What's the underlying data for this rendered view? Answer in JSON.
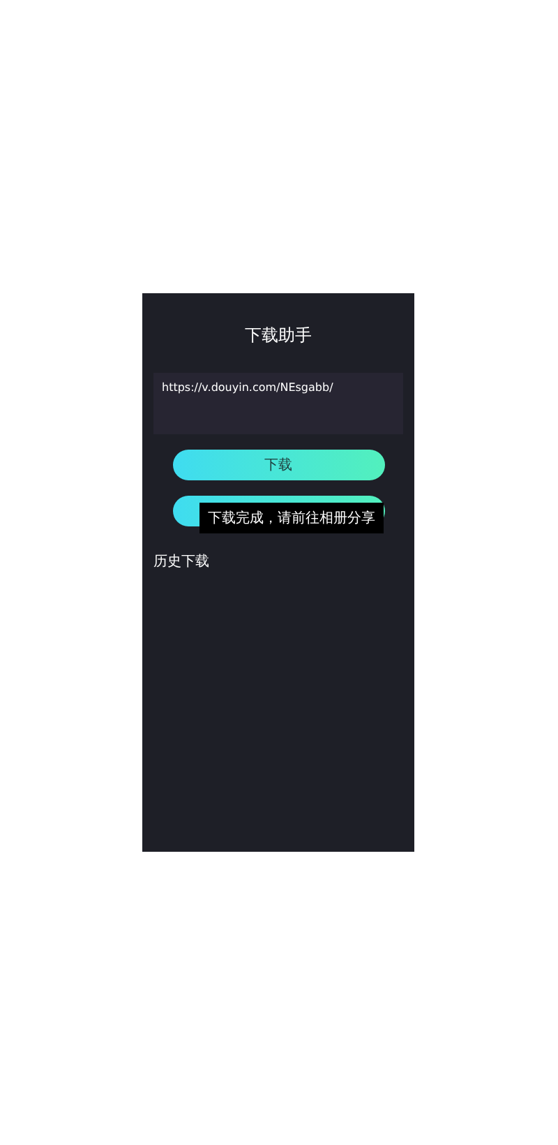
{
  "title": "下载助手",
  "url_field": {
    "value": "https://v.douyin.com/NEsgabb/"
  },
  "buttons": [
    {
      "kind": "labeled",
      "label": "下载"
    },
    {
      "kind": "covered"
    }
  ],
  "toast": "下载完成，请前往相册分享",
  "history_heading": "历史下载"
}
